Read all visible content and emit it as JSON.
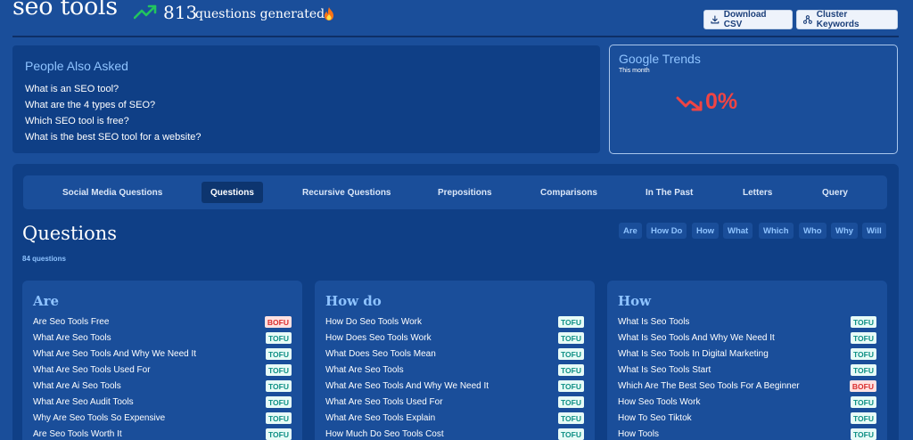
{
  "header": {
    "keyword": "seo tools",
    "count": "813",
    "count_suffix": "questions generated",
    "download_label": "Download CSV",
    "cluster_label": "Cluster Keywords"
  },
  "people_also_asked": {
    "title": "People Also Asked",
    "questions": [
      "What is an SEO tool?",
      "What are the 4 types of SEO?",
      "Which SEO tool is free?",
      "What is the best SEO tool for a website?"
    ]
  },
  "google_trends": {
    "title": "Google Trends",
    "period": "This month",
    "change": "0%",
    "change_color": "#ef4444"
  },
  "tabs": [
    "Social Media Questions",
    "Questions",
    "Recursive Questions",
    "Prepositions",
    "Comparisons",
    "In The Past",
    "Letters",
    "Query"
  ],
  "active_tab": "Questions",
  "section": {
    "title": "Questions",
    "count_label": "84 questions",
    "filters": [
      "Are",
      "How Do",
      "How",
      "What",
      "Which",
      "Who",
      "Why",
      "Will"
    ]
  },
  "cards": [
    {
      "title": "Are",
      "rows": [
        {
          "text": "Are Seo Tools Free",
          "tag": "BOFU"
        },
        {
          "text": "What Are Seo Tools",
          "tag": "TOFU"
        },
        {
          "text": "What Are Seo Tools And Why We Need It",
          "tag": "TOFU"
        },
        {
          "text": "What Are Seo Tools Used For",
          "tag": "TOFU"
        },
        {
          "text": "What Are Ai Seo Tools",
          "tag": "TOFU"
        },
        {
          "text": "What Are Seo Audit Tools",
          "tag": "TOFU"
        },
        {
          "text": "Why Are Seo Tools So Expensive",
          "tag": "TOFU"
        },
        {
          "text": "Are Seo Tools Worth It",
          "tag": "TOFU"
        }
      ]
    },
    {
      "title": "How do",
      "rows": [
        {
          "text": "How Do Seo Tools Work",
          "tag": "TOFU"
        },
        {
          "text": "How Does Seo Tools Work",
          "tag": "TOFU"
        },
        {
          "text": "What Does Seo Tools Mean",
          "tag": "TOFU"
        },
        {
          "text": "What Are Seo Tools",
          "tag": "TOFU"
        },
        {
          "text": "What Are Seo Tools And Why We Need It",
          "tag": "TOFU"
        },
        {
          "text": "What Are Seo Tools Used For",
          "tag": "TOFU"
        },
        {
          "text": "What Are Seo Tools Explain",
          "tag": "TOFU"
        },
        {
          "text": "How Much Do Seo Tools Cost",
          "tag": "TOFU"
        }
      ]
    },
    {
      "title": "How",
      "rows": [
        {
          "text": "What Is Seo Tools",
          "tag": "TOFU"
        },
        {
          "text": "What Is Seo Tools And Why We Need It",
          "tag": "TOFU"
        },
        {
          "text": "What Is Seo Tools In Digital Marketing",
          "tag": "TOFU"
        },
        {
          "text": "What Is Seo Tools Start",
          "tag": "TOFU"
        },
        {
          "text": "Which Are The Best Seo Tools For A Beginner",
          "tag": "BOFU"
        },
        {
          "text": "How Seo Tools Work",
          "tag": "TOFU"
        },
        {
          "text": "How To Seo Tiktok",
          "tag": "TOFU"
        },
        {
          "text": "How Tools",
          "tag": "TOFU"
        }
      ]
    }
  ]
}
